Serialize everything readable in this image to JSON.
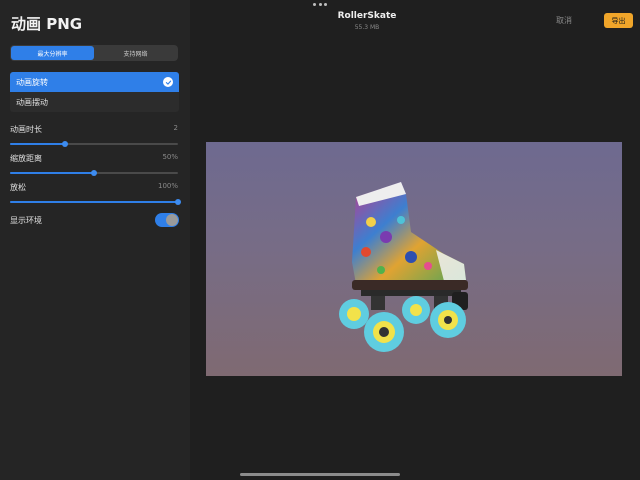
{
  "sidebar": {
    "title": "动画 PNG",
    "segments": [
      {
        "label": "最大分辨率",
        "active": true
      },
      {
        "label": "支持网络",
        "active": false
      }
    ],
    "options": [
      {
        "label": "动画旋转",
        "selected": true
      },
      {
        "label": "动画摆动",
        "selected": false
      }
    ],
    "sliders": [
      {
        "label": "动画时长",
        "value_text": "2",
        "fraction": 0.33
      },
      {
        "label": "缩放距离",
        "value_text": "50%",
        "fraction": 0.5
      },
      {
        "label": "放松",
        "value_text": "100%",
        "fraction": 1.0
      }
    ],
    "toggle": {
      "label": "显示环境",
      "on": true
    }
  },
  "header": {
    "file_title": "RollerSkate",
    "file_size": "55.3 MB",
    "cancel_label": "取消",
    "export_label": "导出"
  },
  "icons": {
    "more": "more-dots-icon",
    "check": "checkmark-icon"
  },
  "colors": {
    "accent": "#2f7fe8",
    "export": "#f0a52a",
    "wheel": "#5fcde0"
  }
}
